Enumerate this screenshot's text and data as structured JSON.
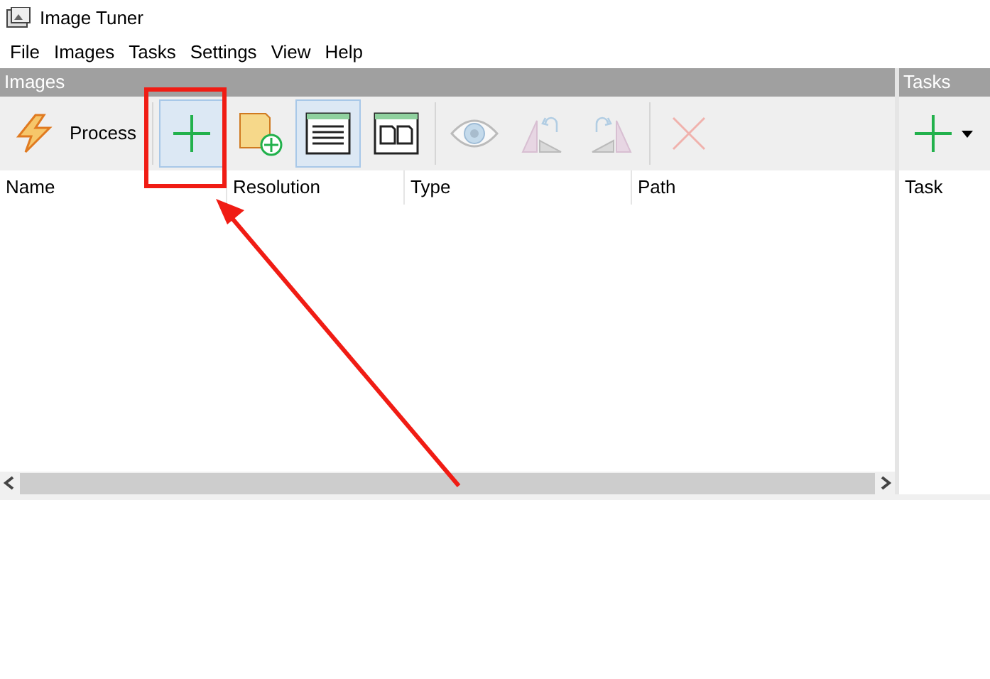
{
  "window": {
    "title": "Image Tuner"
  },
  "menu": [
    "File",
    "Images",
    "Tasks",
    "Settings",
    "View",
    "Help"
  ],
  "images_panel": {
    "title": "Images",
    "toolbar": [
      {
        "kind": "process",
        "label": "Process",
        "selected": false,
        "disabled": false
      },
      {
        "kind": "add",
        "selected": true,
        "disabled": false
      },
      {
        "kind": "add-folder",
        "selected": false,
        "disabled": false
      },
      {
        "kind": "list-view",
        "selected": true,
        "disabled": false
      },
      {
        "kind": "thumb-view",
        "selected": false,
        "disabled": false
      },
      {
        "kind": "preview",
        "selected": false,
        "disabled": true
      },
      {
        "kind": "rotate-left",
        "selected": false,
        "disabled": true
      },
      {
        "kind": "rotate-right",
        "selected": false,
        "disabled": true
      },
      {
        "kind": "remove",
        "selected": false,
        "disabled": true
      }
    ],
    "columns": [
      "Name",
      "Resolution",
      "Type",
      "Path"
    ]
  },
  "tasks_panel": {
    "title": "Tasks",
    "columns": [
      "Task"
    ]
  }
}
